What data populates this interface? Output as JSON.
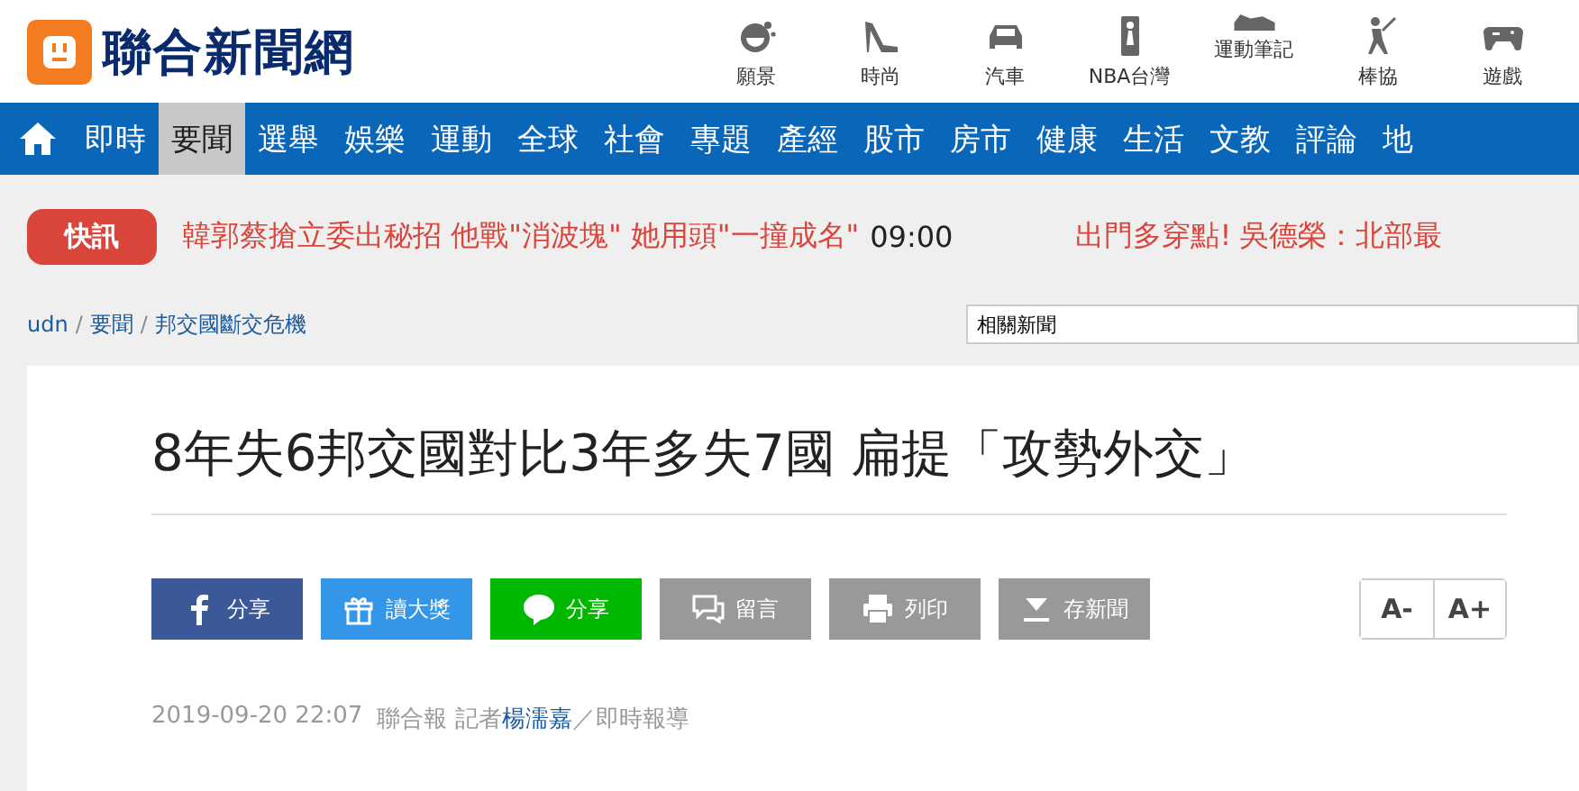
{
  "logo": {
    "text": "聯合新聞網"
  },
  "channels": [
    {
      "label": "願景"
    },
    {
      "label": "時尚"
    },
    {
      "label": "汽車"
    },
    {
      "label": "NBA台灣"
    },
    {
      "label": "運動筆記"
    },
    {
      "label": "棒協"
    },
    {
      "label": "遊戲"
    }
  ],
  "nav": [
    {
      "label": "即時",
      "selected": false
    },
    {
      "label": "要聞",
      "selected": true
    },
    {
      "label": "選舉",
      "selected": false
    },
    {
      "label": "娛樂",
      "selected": false
    },
    {
      "label": "運動",
      "selected": false
    },
    {
      "label": "全球",
      "selected": false
    },
    {
      "label": "社會",
      "selected": false
    },
    {
      "label": "專題",
      "selected": false
    },
    {
      "label": "產經",
      "selected": false
    },
    {
      "label": "股市",
      "selected": false
    },
    {
      "label": "房市",
      "selected": false
    },
    {
      "label": "健康",
      "selected": false
    },
    {
      "label": "生活",
      "selected": false
    },
    {
      "label": "文教",
      "selected": false
    },
    {
      "label": "評論",
      "selected": false
    },
    {
      "label": "地",
      "selected": false
    }
  ],
  "ticker": {
    "badge": "快訊",
    "items": [
      {
        "headline": "韓郭蔡搶立委出秘招 他戰\"消波塊\" 她用頭\"一撞成名\"",
        "time": "09:00"
      },
      {
        "headline": "出門多穿點! 吳德榮：北部最"
      }
    ]
  },
  "breadcrumb": {
    "separator": "/",
    "items": [
      "udn",
      "要聞",
      "邦交國斷交危機"
    ]
  },
  "search": {
    "value": "相關新聞"
  },
  "article": {
    "title": "8年失6邦交國對比3年多失7國 扁提「攻勢外交」",
    "share_buttons": [
      {
        "label": "分享",
        "color": "#3b5998"
      },
      {
        "label": "讀大獎",
        "color": "#3396e8"
      },
      {
        "label": "分享",
        "color": "#00b900"
      },
      {
        "label": "留言",
        "color": "#999999"
      },
      {
        "label": "列印",
        "color": "#999999"
      },
      {
        "label": "存新聞",
        "color": "#999999"
      }
    ],
    "font_buttons": [
      "A-",
      "A+"
    ],
    "meta": {
      "date": "2019-09-20 22:07",
      "source": "聯合報",
      "reporter_prefix": "記者",
      "reporter": "楊濡嘉",
      "suffix": "／即時報導"
    }
  }
}
